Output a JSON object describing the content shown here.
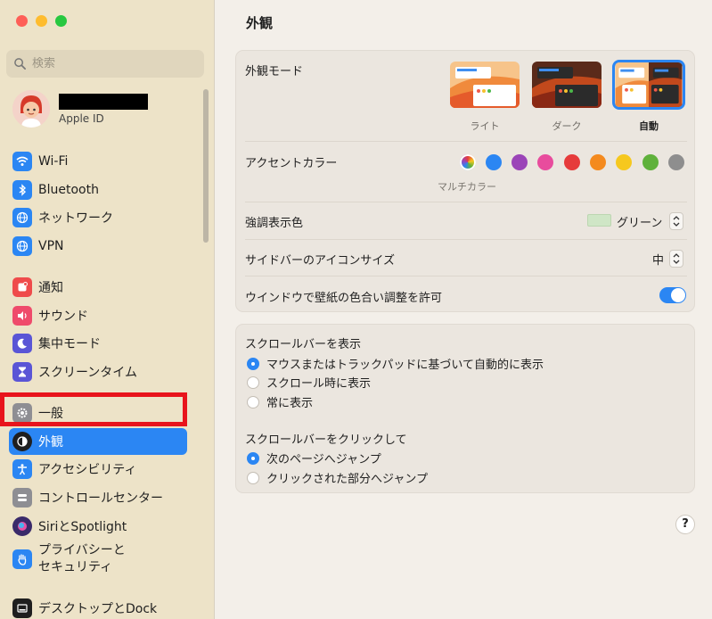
{
  "sidebar": {
    "search_placeholder": "検索",
    "account_label": "Apple ID",
    "groups": [
      [
        {
          "id": "wifi",
          "label": "Wi-Fi",
          "icon": "wifi-icon",
          "color": "#2b86f3"
        },
        {
          "id": "bluetooth",
          "label": "Bluetooth",
          "icon": "bluetooth-icon",
          "color": "#2b86f3"
        },
        {
          "id": "network",
          "label": "ネットワーク",
          "icon": "globe-icon",
          "color": "#2b86f3"
        },
        {
          "id": "vpn",
          "label": "VPN",
          "icon": "vpn-globe-icon",
          "color": "#2b86f3"
        }
      ],
      [
        {
          "id": "notifications",
          "label": "通知",
          "icon": "bell-icon",
          "color": "#ef4b4b"
        },
        {
          "id": "sound",
          "label": "サウンド",
          "icon": "speaker-icon",
          "color": "#ef4b6b"
        },
        {
          "id": "focus",
          "label": "集中モード",
          "icon": "moon-icon",
          "color": "#5a55d6"
        },
        {
          "id": "screentime",
          "label": "スクリーンタイム",
          "icon": "hourglass-icon",
          "color": "#5a55d6"
        }
      ],
      [
        {
          "id": "general",
          "label": "一般",
          "icon": "gear-icon",
          "color": "#8e8e93"
        },
        {
          "id": "appearance",
          "label": "外観",
          "icon": "appearance-icon",
          "color": "#1f1f1f",
          "selected": true
        },
        {
          "id": "accessibility",
          "label": "アクセシビリティ",
          "icon": "accessibility-icon",
          "color": "#2b86f3"
        },
        {
          "id": "controlcenter",
          "label": "コントロールセンター",
          "icon": "control-center-icon",
          "color": "#8e8e93"
        },
        {
          "id": "siri",
          "label": "SiriとSpotlight",
          "icon": "siri-icon",
          "color": "#3a2a6a"
        },
        {
          "id": "privacy",
          "label": "プライバシーとセキュリティ",
          "label_line1": "プライバシーと",
          "label_line2": "セキュリティ",
          "icon": "hand-icon",
          "color": "#2b86f3"
        }
      ],
      [
        {
          "id": "desktop",
          "label": "デスクトップとDock",
          "icon": "dock-icon",
          "color": "#1f1f1f"
        }
      ]
    ]
  },
  "main": {
    "title": "外観",
    "appearance_mode": {
      "label": "外観モード",
      "options": [
        {
          "label": "ライト",
          "selected": false
        },
        {
          "label": "ダーク",
          "selected": false
        },
        {
          "label": "自動",
          "selected": true
        }
      ]
    },
    "accent_color": {
      "label": "アクセントカラー",
      "selected_caption": "マルチカラー",
      "colors": [
        "multicolor",
        "#2b86f3",
        "#9b44b8",
        "#e84c9d",
        "#e63b3b",
        "#f48a1e",
        "#f6c81e",
        "#5fb13b",
        "#8e8e8e"
      ]
    },
    "highlight_color": {
      "label": "強調表示色",
      "value": "グリーン",
      "chip_color": "#cfe6c6"
    },
    "sidebar_icon_size": {
      "label": "サイドバーのアイコンサイズ",
      "value": "中"
    },
    "wallpaper_tinting": {
      "label": "ウインドウで壁紙の色合い調整を許可",
      "on": true
    },
    "show_scrollbars": {
      "label": "スクロールバーを表示",
      "options": [
        {
          "label": "マウスまたはトラックパッドに基づいて自動的に表示",
          "selected": true
        },
        {
          "label": "スクロール時に表示",
          "selected": false
        },
        {
          "label": "常に表示",
          "selected": false
        }
      ]
    },
    "click_scrollbar": {
      "label": "スクロールバーをクリックして",
      "options": [
        {
          "label": "次のページへジャンプ",
          "selected": true
        },
        {
          "label": "クリックされた部分へジャンプ",
          "selected": false
        }
      ]
    },
    "help": "?"
  }
}
